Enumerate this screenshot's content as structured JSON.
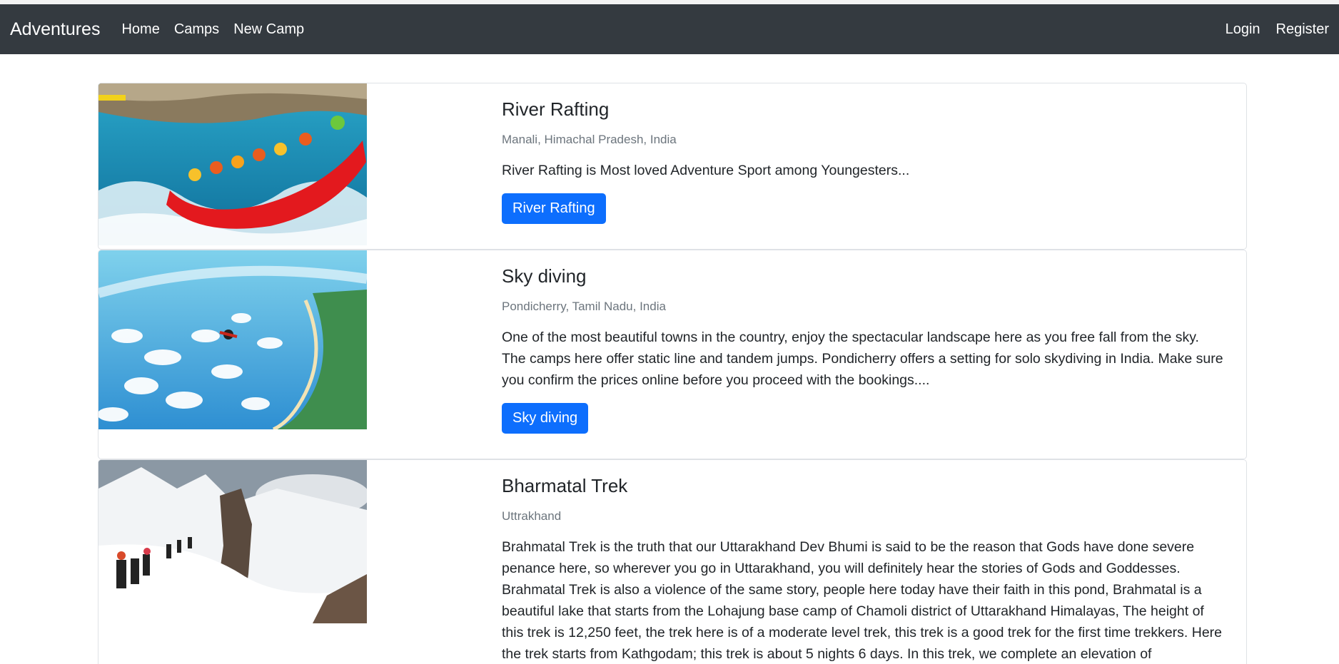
{
  "navbar": {
    "brand": "Adventures",
    "links": [
      "Home",
      "Camps",
      "New Camp"
    ],
    "right_links": [
      "Login",
      "Register"
    ]
  },
  "camps": [
    {
      "title": "River Rafting",
      "location": "Manali, Himachal Pradesh, India",
      "description": "River Rafting is Most loved Adventure Sport among Youngesters...",
      "button": "River Rafting"
    },
    {
      "title": "Sky diving",
      "location": "Pondicherry, Tamil Nadu, India",
      "description": "One of the most beautiful towns in the country, enjoy the spectacular landscape here as you free fall from the sky. The camps here offer static line and tandem jumps. Pondicherry offers a setting for solo skydiving in India. Make sure you confirm the prices online before you proceed with the bookings....",
      "button": "Sky diving"
    },
    {
      "title": "Bharmatal Trek",
      "location": "Uttrakhand",
      "description": "Brahmatal Trek is the truth that our Uttarakhand Dev Bhumi is said to be the reason that Gods have done severe penance here, so wherever you go in Uttarakhand, you will definitely hear the stories of Gods and Goddesses. Brahmatal Trek is also a violence of the same story, people here today have their faith in this pond, Brahmatal is a beautiful lake that starts from the Lohajung base camp of Chamoli district of Uttarakhand Himalayas, The height of this trek is 12,250 feet, the trek here is of a moderate level trek, this trek is a good trek for the first time trekkers. Here the trek starts from Kathgodam; this trek is about 5 nights 6 days. In this trek, we complete an elevation of"
    }
  ]
}
